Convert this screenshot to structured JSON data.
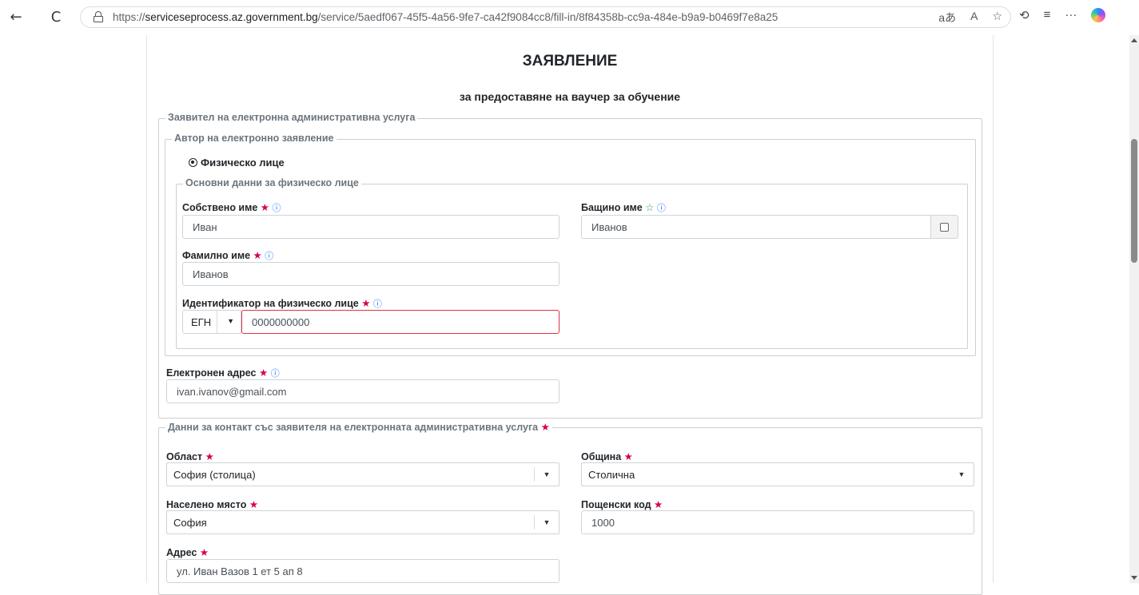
{
  "browser": {
    "url_prefix": "https://",
    "url_host": "serviceseprocess.az.government.bg",
    "url_path": "/service/5aedf067-45f5-4a56-9fe7-ca42f9084cc8/fill-in/8f84358b-cc9a-484e-b9a9-b0469f7e8a25",
    "icons": {
      "back": "←",
      "refresh": "C",
      "translate": "aあ",
      "read_aloud": "A",
      "favorite": "☆",
      "extensions": "⟲",
      "favorites_bar": "≡",
      "more": "···"
    }
  },
  "form": {
    "title": "ЗАЯВЛЕНИЕ",
    "subtitle": "за предоставяне на ваучер за обучение",
    "applicant_legend": "Заявител на електронна административна услуга",
    "author_legend": "Автор на електронно заявление",
    "person_type": "Физическо лице",
    "basic_data_legend": "Основни данни за физическо лице",
    "first_name": {
      "label": "Собствено име",
      "value": "Иван"
    },
    "middle_name": {
      "label": "Бащино име",
      "value": "Иванов"
    },
    "last_name": {
      "label": "Фамилно име",
      "value": "Иванов"
    },
    "identifier": {
      "label": "Идентификатор на физическо лице",
      "type": "ЕГН",
      "value": "0000000000"
    },
    "email": {
      "label": "Електронен адрес",
      "value": "ivan.ivanov@gmail.com"
    },
    "contact_legend": "Данни за контакт със заявителя на електронната административна услуга",
    "region": {
      "label": "Област",
      "value": "София (столица)"
    },
    "municipality": {
      "label": "Община",
      "value": "Столична"
    },
    "settlement": {
      "label": "Населено място",
      "value": "София"
    },
    "postal_code": {
      "label": "Пощенски код",
      "value": "1000"
    },
    "address": {
      "label": "Адрес",
      "value": "ул. Иван Вазов 1 ет 5 ап 8"
    },
    "required_mark": "★",
    "optional_mark": "☆",
    "info_mark": "ⓘ"
  },
  "colors": {
    "required": "#d6004b",
    "optional": "#28a745",
    "info": "#0d6efd",
    "error_border": "#dc3545"
  }
}
